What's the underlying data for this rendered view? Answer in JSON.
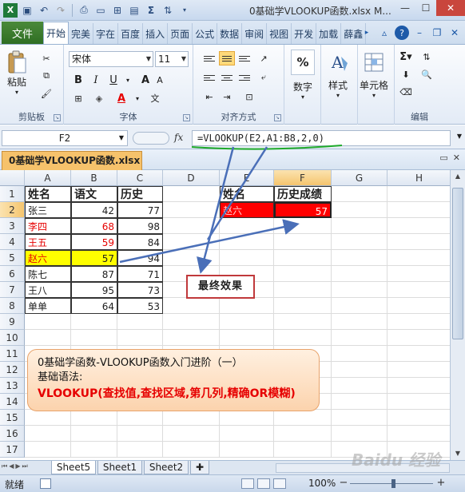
{
  "window": {
    "title": "0基础学VLOOKUP函数.xlsx M..."
  },
  "ribbon_tabs": [
    "文件",
    "开始",
    "完美",
    "字在",
    "百度",
    "插入",
    "页面",
    "公式",
    "数据",
    "审阅",
    "视图",
    "开发",
    "加载",
    "薛鑫"
  ],
  "ribbon": {
    "paste_label": "粘贴",
    "clipboard_label": "剪贴板",
    "font_name": "宋体",
    "font_size": "11",
    "font_label": "字体",
    "align_label": "对齐方式",
    "number_label": "数字",
    "style_label": "样式",
    "cells_label": "单元格",
    "edit_label": "编辑",
    "bold": "B",
    "italic": "I",
    "underline": "U",
    "font_grow": "A",
    "font_color": "A",
    "percent": "%"
  },
  "formula_bar": {
    "name_box": "F2",
    "fx": "fx",
    "formula": "=VLOOKUP(E2,A1:B8,2,0)"
  },
  "workbook_tab": "0基础学VLOOKUP函数.xlsx",
  "grid": {
    "columns": [
      "A",
      "B",
      "C",
      "D",
      "E",
      "F",
      "G",
      "H"
    ],
    "rows": [
      "1",
      "2",
      "3",
      "4",
      "5",
      "6",
      "7",
      "8",
      "9",
      "10",
      "11",
      "12",
      "13",
      "14",
      "15",
      "16",
      "17"
    ],
    "header_row": [
      "姓名",
      "语文",
      "历史"
    ],
    "data": [
      {
        "name": "张三",
        "chinese": "42",
        "history": "77"
      },
      {
        "name": "李四",
        "chinese": "68",
        "history": "98"
      },
      {
        "name": "王五",
        "chinese": "59",
        "history": "84"
      },
      {
        "name": "赵六",
        "chinese": "57",
        "history": "94"
      },
      {
        "name": "陈七",
        "chinese": "87",
        "history": "71"
      },
      {
        "name": "王八",
        "chinese": "95",
        "history": "73"
      },
      {
        "name": "单单",
        "chinese": "64",
        "history": "53"
      }
    ],
    "lookup_header": [
      "姓名",
      "历史成绩"
    ],
    "lookup_value": "赵六",
    "lookup_result": "57"
  },
  "callout": "最终效果",
  "note": {
    "line1": "0基础学函数-VLOOKUP函数入门进阶（一）",
    "line2": "基础语法:",
    "line3": "VLOOKUP(查找值,查找区域,第几列,精确OR模糊)"
  },
  "sheets": [
    "Sheet5",
    "Sheet1",
    "Sheet2"
  ],
  "status": {
    "ready": "就绪",
    "zoom": "100%"
  },
  "watermark": "Baidu 经验",
  "colors": {
    "red_highlight": "#ff0000",
    "yellow_highlight": "#ffff00",
    "red_text": "#e60000",
    "file_tab_green": "#2f6e23"
  }
}
